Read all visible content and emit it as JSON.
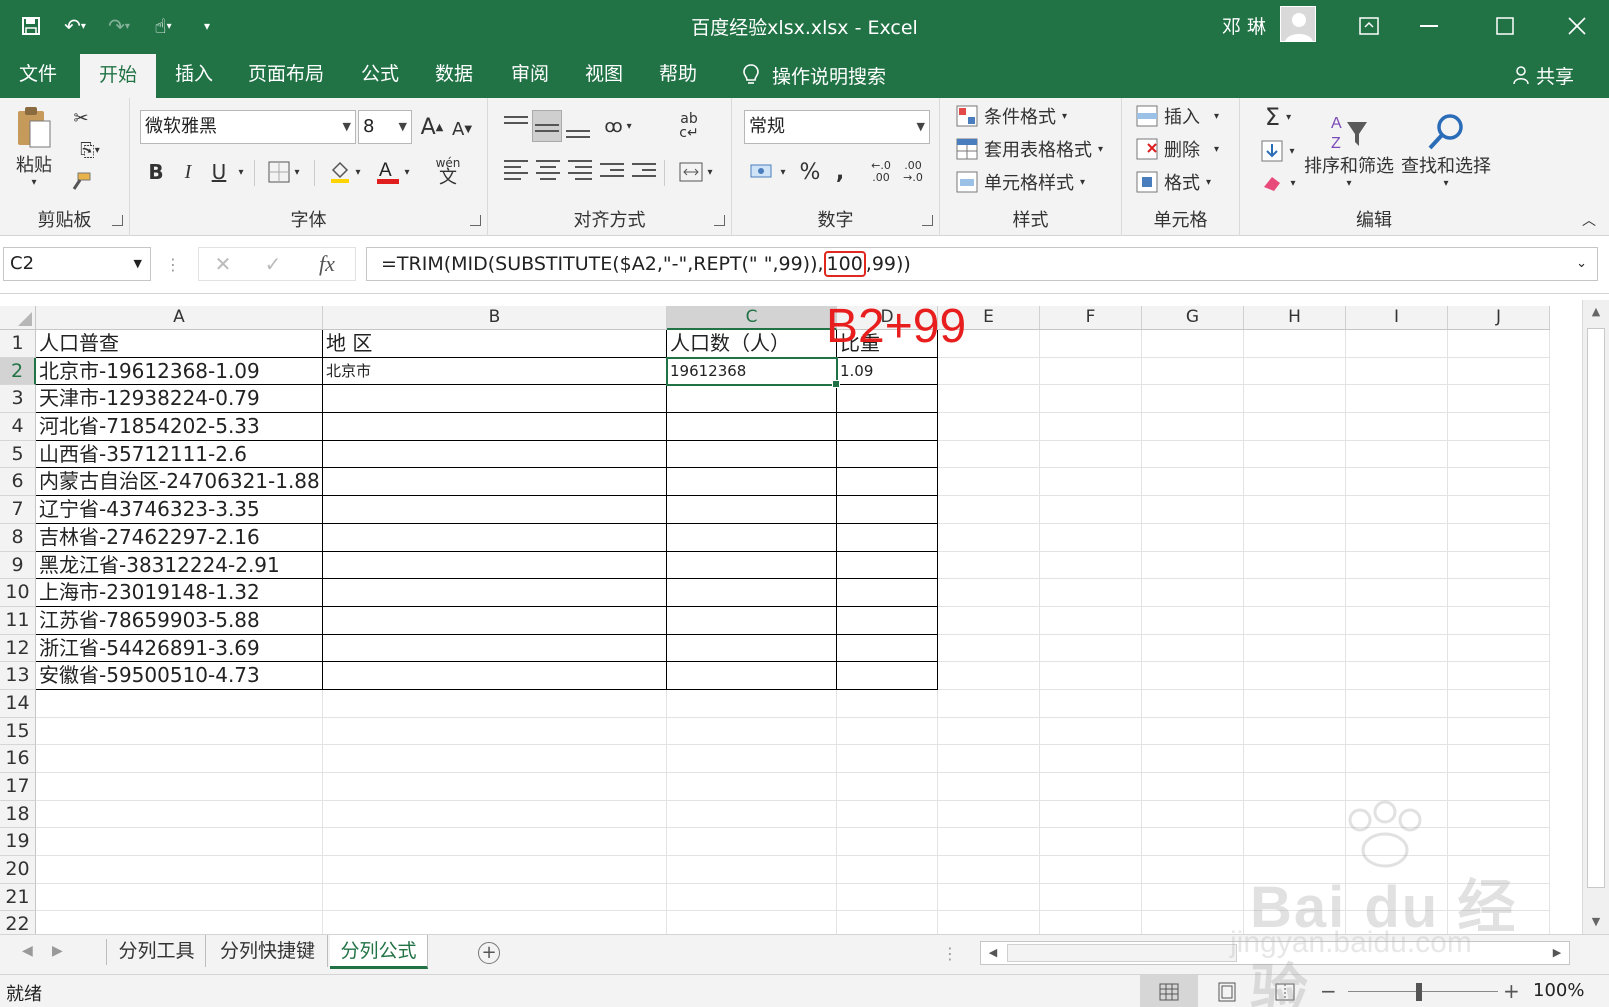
{
  "window": {
    "title": "百度经验xlsx.xlsx  -  Excel",
    "user": "邓 琳"
  },
  "menu": {
    "tabs": [
      "文件",
      "开始",
      "插入",
      "页面布局",
      "公式",
      "数据",
      "审阅",
      "视图",
      "帮助"
    ],
    "active": "开始",
    "tell_me": "操作说明搜索",
    "share": "共享"
  },
  "ribbon": {
    "clipboard": {
      "label": "剪贴板",
      "paste": "粘贴"
    },
    "font": {
      "label": "字体",
      "name": "微软雅黑",
      "size": "8",
      "bold": "B",
      "italic": "I",
      "underline": "U"
    },
    "alignment": {
      "label": "对齐方式"
    },
    "number": {
      "label": "数字",
      "format": "常规",
      "percent": "%",
      "comma": ","
    },
    "styles": {
      "label": "样式",
      "conditional": "条件格式",
      "table": "套用表格格式",
      "cell_styles": "单元格样式"
    },
    "cells": {
      "label": "单元格",
      "insert": "插入",
      "delete": "删除",
      "format": "格式"
    },
    "editing": {
      "label": "编辑",
      "sort_filter": "排序和筛选",
      "find_select": "查找和选择"
    }
  },
  "formula_bar": {
    "name_box": "C2",
    "fx": "fx",
    "formula_before": "=TRIM(MID(SUBSTITUTE($A2,\"-\",REPT(\" \",99)),",
    "formula_highlight": "100",
    "formula_after": ",99))"
  },
  "annotation": "B2+99",
  "grid": {
    "columns": [
      "A",
      "B",
      "C",
      "D",
      "E",
      "F",
      "G",
      "H",
      "I",
      "J"
    ],
    "selected_column": "C",
    "selected_row": "2",
    "rows": [
      "1",
      "2",
      "3",
      "4",
      "5",
      "6",
      "7",
      "8",
      "9",
      "10",
      "11",
      "12",
      "13",
      "14",
      "15",
      "16",
      "17",
      "18",
      "19",
      "20",
      "21",
      "22"
    ],
    "headers": {
      "A": "人口普查",
      "B": "地  区",
      "C": "人口数（人）",
      "D": "比重"
    },
    "row2": {
      "B": "北京市",
      "C": "19612368",
      "D": "1.09"
    },
    "col_a": [
      "北京市-19612368-1.09",
      "天津市-12938224-0.79",
      "河北省-71854202-5.33",
      "山西省-35712111-2.6",
      "内蒙古自治区-24706321-1.88",
      "辽宁省-43746323-3.35",
      "吉林省-27462297-2.16",
      "黑龙江省-38312224-2.91",
      "上海市-23019148-1.32",
      "江苏省-78659903-5.88",
      "浙江省-54426891-3.69",
      "安徽省-59500510-4.73"
    ]
  },
  "sheets": [
    "分列工具",
    "分列快捷键",
    "分列公式"
  ],
  "active_sheet": "分列公式",
  "status": {
    "ready": "就绪",
    "zoom": "100%"
  },
  "watermark": {
    "brand": "Bai du 经验",
    "url": "jingyan.baidu.com"
  }
}
